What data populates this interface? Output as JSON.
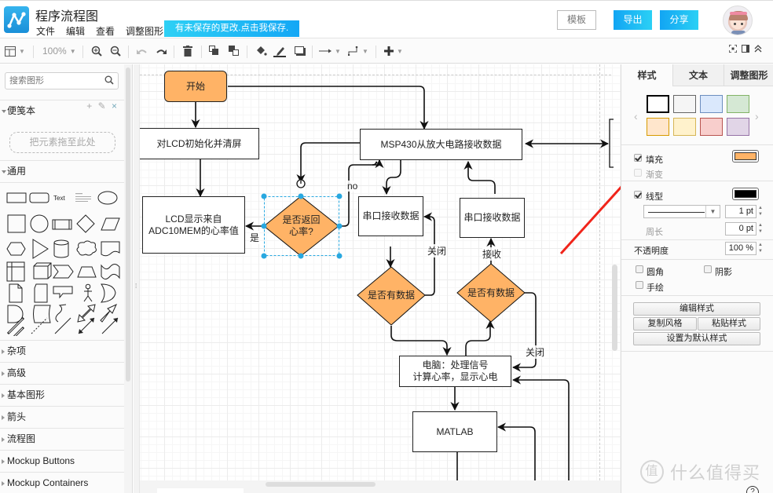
{
  "app": {
    "title": "程序流程图",
    "menu": [
      "文件",
      "编辑",
      "查看",
      "调整图形"
    ],
    "unsaved_notice": "有未保存的更改.点击我保存.",
    "template_button": "模板",
    "export_button": "导出",
    "share_button": "分享",
    "avatar": "user-avatar"
  },
  "toolbar": {
    "zoom_level": "100%",
    "left_icons": [
      "page-layout-icon",
      "zoom-in-icon",
      "zoom-out-icon",
      "undo-icon",
      "redo-icon",
      "delete-icon",
      "to-front-icon",
      "to-back-icon",
      "fill-color-icon",
      "line-color-icon",
      "shadow-icon",
      "connection-icon",
      "waypoint-icon",
      "insert-plus-icon"
    ],
    "right_icons": [
      "fullscreen-icon",
      "format-panel-icon",
      "collapse-icon"
    ]
  },
  "sidebar": {
    "search_placeholder": "搜索图形",
    "scratchpad": {
      "title": "便笺本",
      "actions": [
        "+",
        "✎",
        "×"
      ],
      "dropzone": "把元素拖至此处"
    },
    "general": {
      "title": "通用",
      "text_shape_label": "Text"
    },
    "collapsed_sections": [
      "杂项",
      "高级",
      "基本图形",
      "箭头",
      "流程图",
      "Mockup Buttons",
      "Mockup Containers"
    ]
  },
  "diagram": {
    "nodes": {
      "start": "开始",
      "lcd_init": "对LCD初始化并清屏",
      "lcd_display_1": "LCD显示来自",
      "lcd_display_2": "ADC10MEM的心率值",
      "return_rate_1": "是否返回",
      "return_rate_2": "心率?",
      "msp430": "MSP430从放大电路接收数据",
      "serial_rx_left": "串口接收数据",
      "serial_rx_right": "串口接收数据",
      "has_data_left": "是否有数据",
      "has_data_right": "是否有数据",
      "pc_1": "电脑：处理信号",
      "pc_2": "计算心率，显示心电",
      "matlab": "MATLAB"
    },
    "edge_labels": {
      "no": "no",
      "yes": "是",
      "close_left": "关闭",
      "receive": "接收",
      "close_right": "关闭"
    },
    "colors": {
      "decision_fill": "#FFB366",
      "start_fill": "#FFB366",
      "selection": "#29A8E0"
    }
  },
  "format_panel": {
    "tabs": [
      "样式",
      "文本",
      "调整图形"
    ],
    "active_tab": "样式",
    "swatches": [
      {
        "fill": "#FFFFFF",
        "stroke": "#000000"
      },
      {
        "fill": "#F5F5F5",
        "stroke": "#666666"
      },
      {
        "fill": "#DAE8FC",
        "stroke": "#6C8EBF"
      },
      {
        "fill": "#D5E8D4",
        "stroke": "#82B366"
      },
      {
        "fill": "#FFE6CC",
        "stroke": "#D79B00"
      },
      {
        "fill": "#FFF2CC",
        "stroke": "#D6B656"
      },
      {
        "fill": "#F8CECC",
        "stroke": "#B85450"
      },
      {
        "fill": "#E1D5E7",
        "stroke": "#9673A6"
      }
    ],
    "fill": {
      "label": "填充",
      "checked": true,
      "color": "#FFB366"
    },
    "gradient": {
      "label": "渐变",
      "checked": false
    },
    "line": {
      "label": "线型",
      "checked": true,
      "color": "#000000",
      "width": "1 pt"
    },
    "perimeter": {
      "label": "周长",
      "value": "0 pt"
    },
    "opacity": {
      "label": "不透明度",
      "value": "100 %"
    },
    "rounded": {
      "label": "圆角",
      "checked": false
    },
    "shadow": {
      "label": "阴影",
      "checked": false
    },
    "sketch": {
      "label": "手绘",
      "checked": false
    },
    "buttons": {
      "edit_style": "编辑样式",
      "copy_style": "复制风格",
      "paste_style": "粘贴样式",
      "set_default": "设置为默认样式"
    }
  },
  "watermark": {
    "badge": "值",
    "text": "什么值得买"
  },
  "help": "?"
}
